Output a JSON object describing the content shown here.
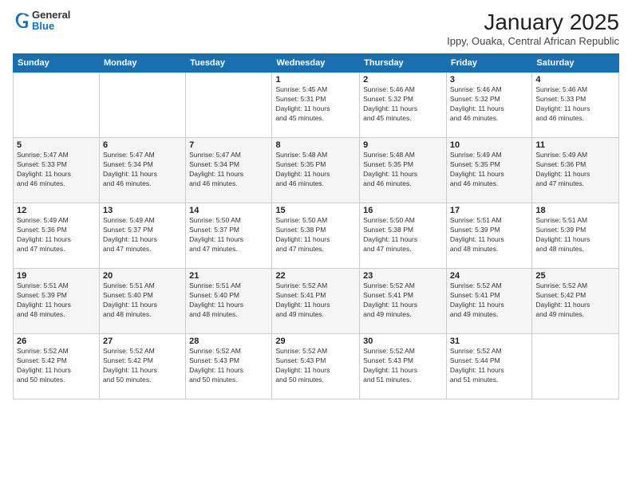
{
  "logo": {
    "general": "General",
    "blue": "Blue"
  },
  "header": {
    "month": "January 2025",
    "location": "Ippy, Ouaka, Central African Republic"
  },
  "days_of_week": [
    "Sunday",
    "Monday",
    "Tuesday",
    "Wednesday",
    "Thursday",
    "Friday",
    "Saturday"
  ],
  "weeks": [
    [
      {
        "day": "",
        "info": ""
      },
      {
        "day": "",
        "info": ""
      },
      {
        "day": "",
        "info": ""
      },
      {
        "day": "1",
        "info": "Sunrise: 5:45 AM\nSunset: 5:31 PM\nDaylight: 11 hours\nand 45 minutes."
      },
      {
        "day": "2",
        "info": "Sunrise: 5:46 AM\nSunset: 5:32 PM\nDaylight: 11 hours\nand 45 minutes."
      },
      {
        "day": "3",
        "info": "Sunrise: 5:46 AM\nSunset: 5:32 PM\nDaylight: 11 hours\nand 46 minutes."
      },
      {
        "day": "4",
        "info": "Sunrise: 5:46 AM\nSunset: 5:33 PM\nDaylight: 11 hours\nand 46 minutes."
      }
    ],
    [
      {
        "day": "5",
        "info": "Sunrise: 5:47 AM\nSunset: 5:33 PM\nDaylight: 11 hours\nand 46 minutes."
      },
      {
        "day": "6",
        "info": "Sunrise: 5:47 AM\nSunset: 5:34 PM\nDaylight: 11 hours\nand 46 minutes."
      },
      {
        "day": "7",
        "info": "Sunrise: 5:47 AM\nSunset: 5:34 PM\nDaylight: 11 hours\nand 46 minutes."
      },
      {
        "day": "8",
        "info": "Sunrise: 5:48 AM\nSunset: 5:35 PM\nDaylight: 11 hours\nand 46 minutes."
      },
      {
        "day": "9",
        "info": "Sunrise: 5:48 AM\nSunset: 5:35 PM\nDaylight: 11 hours\nand 46 minutes."
      },
      {
        "day": "10",
        "info": "Sunrise: 5:49 AM\nSunset: 5:35 PM\nDaylight: 11 hours\nand 46 minutes."
      },
      {
        "day": "11",
        "info": "Sunrise: 5:49 AM\nSunset: 5:36 PM\nDaylight: 11 hours\nand 47 minutes."
      }
    ],
    [
      {
        "day": "12",
        "info": "Sunrise: 5:49 AM\nSunset: 5:36 PM\nDaylight: 11 hours\nand 47 minutes."
      },
      {
        "day": "13",
        "info": "Sunrise: 5:49 AM\nSunset: 5:37 PM\nDaylight: 11 hours\nand 47 minutes."
      },
      {
        "day": "14",
        "info": "Sunrise: 5:50 AM\nSunset: 5:37 PM\nDaylight: 11 hours\nand 47 minutes."
      },
      {
        "day": "15",
        "info": "Sunrise: 5:50 AM\nSunset: 5:38 PM\nDaylight: 11 hours\nand 47 minutes."
      },
      {
        "day": "16",
        "info": "Sunrise: 5:50 AM\nSunset: 5:38 PM\nDaylight: 11 hours\nand 47 minutes."
      },
      {
        "day": "17",
        "info": "Sunrise: 5:51 AM\nSunset: 5:39 PM\nDaylight: 11 hours\nand 48 minutes."
      },
      {
        "day": "18",
        "info": "Sunrise: 5:51 AM\nSunset: 5:39 PM\nDaylight: 11 hours\nand 48 minutes."
      }
    ],
    [
      {
        "day": "19",
        "info": "Sunrise: 5:51 AM\nSunset: 5:39 PM\nDaylight: 11 hours\nand 48 minutes."
      },
      {
        "day": "20",
        "info": "Sunrise: 5:51 AM\nSunset: 5:40 PM\nDaylight: 11 hours\nand 48 minutes."
      },
      {
        "day": "21",
        "info": "Sunrise: 5:51 AM\nSunset: 5:40 PM\nDaylight: 11 hours\nand 48 minutes."
      },
      {
        "day": "22",
        "info": "Sunrise: 5:52 AM\nSunset: 5:41 PM\nDaylight: 11 hours\nand 49 minutes."
      },
      {
        "day": "23",
        "info": "Sunrise: 5:52 AM\nSunset: 5:41 PM\nDaylight: 11 hours\nand 49 minutes."
      },
      {
        "day": "24",
        "info": "Sunrise: 5:52 AM\nSunset: 5:41 PM\nDaylight: 11 hours\nand 49 minutes."
      },
      {
        "day": "25",
        "info": "Sunrise: 5:52 AM\nSunset: 5:42 PM\nDaylight: 11 hours\nand 49 minutes."
      }
    ],
    [
      {
        "day": "26",
        "info": "Sunrise: 5:52 AM\nSunset: 5:42 PM\nDaylight: 11 hours\nand 50 minutes."
      },
      {
        "day": "27",
        "info": "Sunrise: 5:52 AM\nSunset: 5:42 PM\nDaylight: 11 hours\nand 50 minutes."
      },
      {
        "day": "28",
        "info": "Sunrise: 5:52 AM\nSunset: 5:43 PM\nDaylight: 11 hours\nand 50 minutes."
      },
      {
        "day": "29",
        "info": "Sunrise: 5:52 AM\nSunset: 5:43 PM\nDaylight: 11 hours\nand 50 minutes."
      },
      {
        "day": "30",
        "info": "Sunrise: 5:52 AM\nSunset: 5:43 PM\nDaylight: 11 hours\nand 51 minutes."
      },
      {
        "day": "31",
        "info": "Sunrise: 5:52 AM\nSunset: 5:44 PM\nDaylight: 11 hours\nand 51 minutes."
      },
      {
        "day": "",
        "info": ""
      }
    ]
  ]
}
